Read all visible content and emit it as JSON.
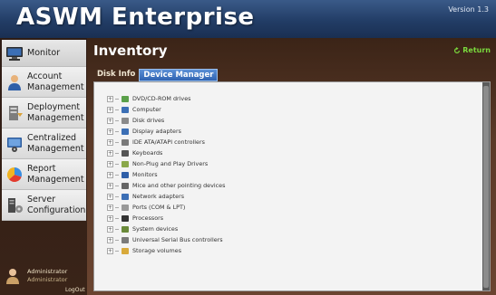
{
  "app": {
    "title": "ASWM Enterprise",
    "version": "Version 1.3"
  },
  "sidebar": {
    "items": [
      {
        "label": "Monitor",
        "icon": "monitor-icon"
      },
      {
        "label": "Account\nManagement",
        "icon": "users-icon"
      },
      {
        "label": "Deployment\nManagement",
        "icon": "deployment-icon"
      },
      {
        "label": "Centralized\nManagement",
        "icon": "centralized-icon"
      },
      {
        "label": "Report\nManagement",
        "icon": "report-chart-icon"
      },
      {
        "label": "Server\nConfiguration",
        "icon": "server-icon"
      }
    ],
    "user": {
      "name": "Administrator",
      "role": "Administrator",
      "logout_label": "LogOut"
    }
  },
  "page": {
    "title": "Inventory",
    "return_label": "Return"
  },
  "tabs": [
    {
      "label": "Disk Info",
      "active": false
    },
    {
      "label": "Device Manager",
      "active": true
    }
  ],
  "device_tree": [
    {
      "label": "DVD/CD-ROM drives",
      "icon": "disc-drive-icon"
    },
    {
      "label": "Computer",
      "icon": "computer-icon"
    },
    {
      "label": "Disk drives",
      "icon": "disk-drive-icon"
    },
    {
      "label": "Display adapters",
      "icon": "display-adapter-icon"
    },
    {
      "label": "IDE ATA/ATAPI controllers",
      "icon": "ide-controller-icon"
    },
    {
      "label": "Keyboards",
      "icon": "keyboard-icon"
    },
    {
      "label": "Non-Plug and Play Drivers",
      "icon": "driver-icon"
    },
    {
      "label": "Monitors",
      "icon": "monitor-device-icon"
    },
    {
      "label": "Mice and other pointing devices",
      "icon": "mouse-icon"
    },
    {
      "label": "Network adapters",
      "icon": "network-adapter-icon"
    },
    {
      "label": "Ports (COM & LPT)",
      "icon": "port-icon"
    },
    {
      "label": "Processors",
      "icon": "processor-icon"
    },
    {
      "label": "System devices",
      "icon": "system-device-icon"
    },
    {
      "label": "Universal Serial Bus controllers",
      "icon": "usb-icon"
    },
    {
      "label": "Storage volumes",
      "icon": "storage-volume-icon"
    }
  ],
  "colors": {
    "header_blue": "#223d66",
    "return_green": "#7ad93d",
    "active_tab_blue": "#2f63b1",
    "panel_bg": "#f3f3f3"
  }
}
